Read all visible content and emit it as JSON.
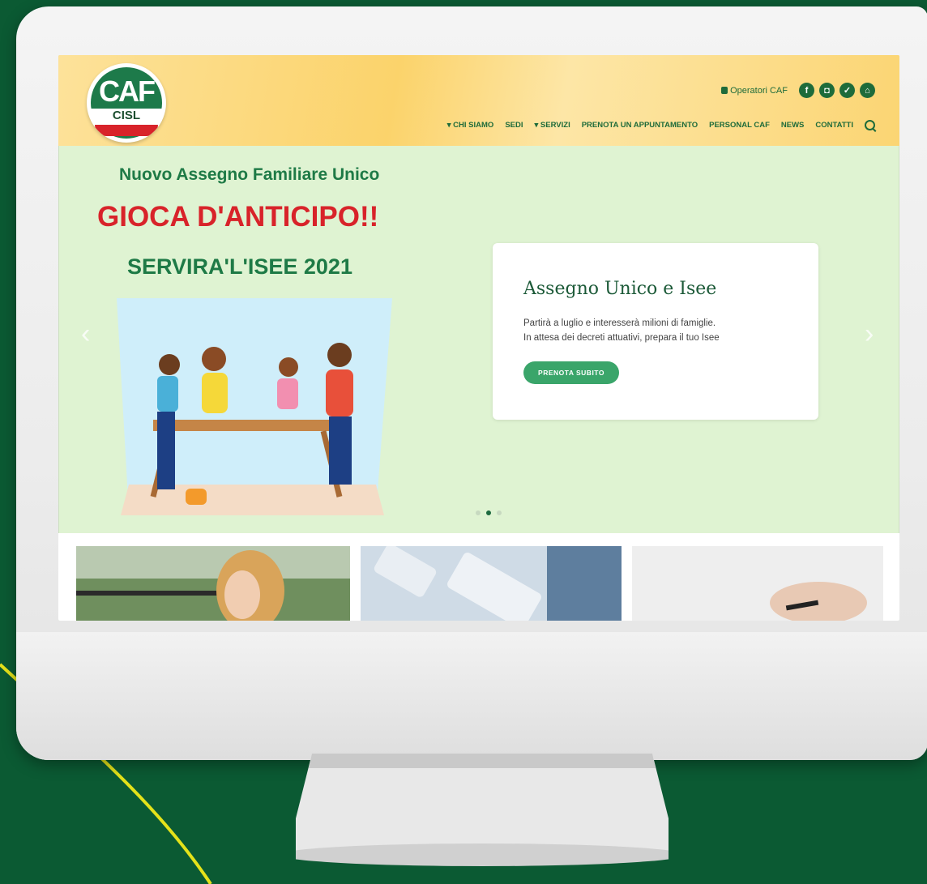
{
  "colors": {
    "background": "#0b5a33",
    "brand_green": "#1e6b3a",
    "accent_red": "#d8232a",
    "header_yellow": "#fbd36b",
    "hero_bg": "#dff3d2"
  },
  "logo": {
    "text": "CAF",
    "subtext": "CISL"
  },
  "top_links": {
    "operatori": "Operatori CAF",
    "social_icons": [
      "facebook-icon",
      "instagram-icon",
      "twitter-icon",
      "home-icon"
    ]
  },
  "nav": {
    "items": [
      "▾ CHI SIAMO",
      "SEDI",
      "▾ SERVIZI",
      "PRENOTA UN APPUNTAMENTO",
      "PERSONAL CAF",
      "NEWS",
      "CONTATTI"
    ]
  },
  "hero": {
    "line1": "Nuovo Assegno Familiare Unico",
    "line2": "GIOCA D'ANTICIPO!!",
    "line3": "SERVIRA'L'ISEE 2021",
    "card_title": "Assegno Unico e Isee",
    "card_text_1": "Partirà a luglio e interesserà milioni di famiglie.",
    "card_text_2": "In attesa dei decreti attuativi, prepara il tuo Isee",
    "card_button": "PRENOTA SUBITO",
    "prev_arrow": "‹",
    "next_arrow": "›",
    "slide_count": 3,
    "active_slide": 2
  }
}
